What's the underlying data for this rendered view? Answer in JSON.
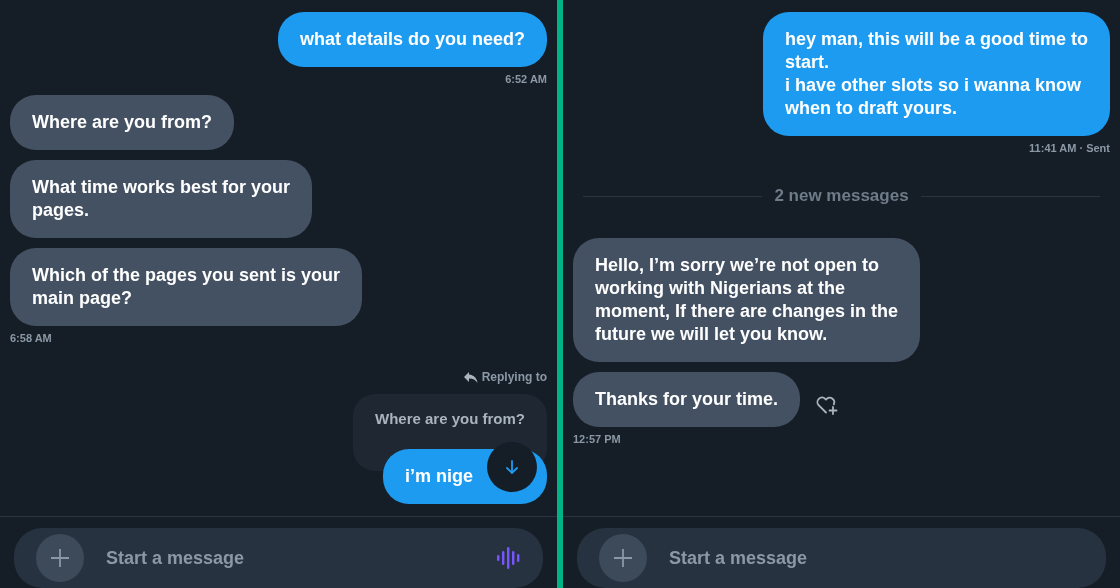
{
  "panels": [
    {
      "messages": [
        {
          "kind": "message",
          "outgoing": true,
          "text": "what details do you need?",
          "time": "6:52 AM"
        },
        {
          "kind": "message",
          "outgoing": false,
          "text": "Where are you from?"
        },
        {
          "kind": "message",
          "outgoing": false,
          "text": "What time works best for your\npages."
        },
        {
          "kind": "message",
          "outgoing": false,
          "text": "Which of the pages you sent is your\nmain page?",
          "time": "6:58 AM"
        },
        {
          "kind": "reply",
          "label": "Replying to",
          "quote": "Where are you from?",
          "outgoing": true,
          "text": "i’m nige",
          "scroll_button": true
        }
      ],
      "composer": {
        "placeholder": "Start a message",
        "voice_button": true
      }
    },
    {
      "messages": [
        {
          "kind": "message",
          "outgoing": true,
          "text": "hey man, this will be a good time to\nstart.\ni have other slots so i wanna know\nwhen to draft yours.",
          "time": "11:41 AM · Sent"
        },
        {
          "kind": "divider",
          "text": "2 new messages"
        },
        {
          "kind": "message",
          "outgoing": false,
          "text": "Hello, I’m sorry we’re not open to\nworking with Nigerians at the\nmoment, If there are changes in the\nfuture we will let you know."
        },
        {
          "kind": "message",
          "outgoing": false,
          "text": "Thanks for your time.",
          "time": "12:57 PM",
          "reaction_button": true
        }
      ],
      "composer": {
        "placeholder": "Start a message",
        "voice_button": false
      }
    }
  ]
}
